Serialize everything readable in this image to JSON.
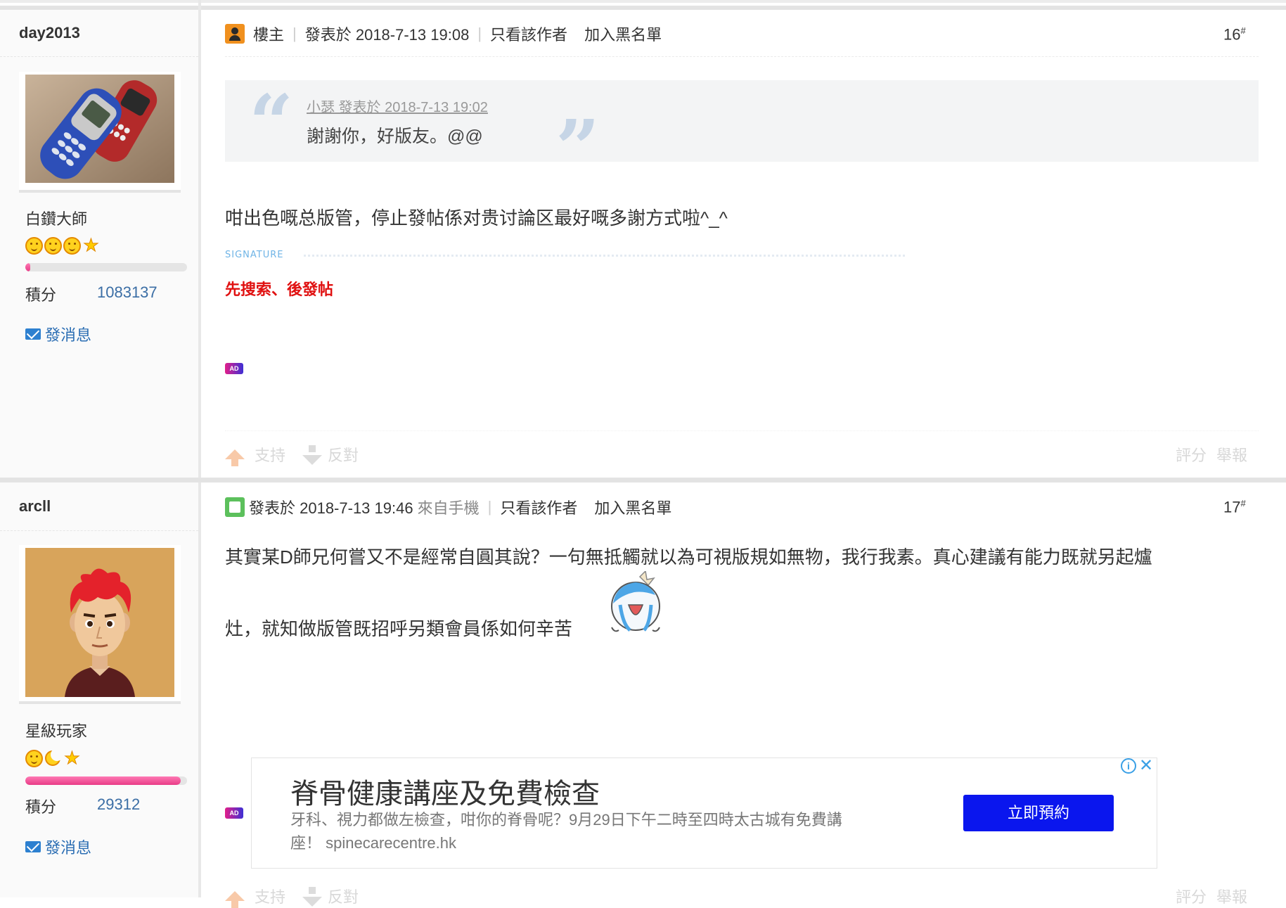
{
  "posts": [
    {
      "username": "day2013",
      "rank": "白鑽大師",
      "points_label": "積分",
      "points_value": "1083137",
      "progress": 0.02,
      "send_msg": "發消息",
      "owner_label": "樓主",
      "posted_at": "發表於 2018-7-13 19:08",
      "only_author": "只看該作者",
      "blacklist": "加入黑名單",
      "floor": "16",
      "floor_sup": "#",
      "quote_from": "小瑟 發表於 2018-7-13 19:02",
      "quote_text": "謝謝你，好版友。@@",
      "content": "咁出色嘅总版管，停止發帖係对贵讨論区最好嘅多謝方式啦^_^",
      "signature_label": "SIGNATURE",
      "signature": "先搜索、後發帖",
      "ad_tag": "AD",
      "support": "支持",
      "oppose": "反對",
      "rate": "評分",
      "report": "舉報"
    },
    {
      "username": "arcll",
      "rank": "星級玩家",
      "points_label": "積分",
      "points_value": "29312",
      "progress": 0.96,
      "send_msg": "發消息",
      "posted_at": "發表於 2018-7-13 19:46",
      "from_mobile": "來自手機",
      "only_author": "只看該作者",
      "blacklist": "加入黑名單",
      "floor": "17",
      "floor_sup": "#",
      "content_line1": "其實某D師兄何嘗又不是經常自圓其說？一句無抵觸就以為可視版規如無物，我行我素。真心建議有能力既就另起爐",
      "content_line2": "灶，就知做版管既招呼另類會員係如何辛苦",
      "ad_tag": "AD",
      "support": "支持",
      "oppose": "反對",
      "rate": "評分",
      "report": "舉報"
    }
  ],
  "ad": {
    "title": "脊骨健康講座及免費檢查",
    "desc_line1": "牙科、視力都做左檢查，咁你的脊骨呢？9月29日下午二時至四時太古城有免費講",
    "desc_line2": "座！ spinecarecentre.hk",
    "button": "立即預約",
    "info": "i",
    "close": "✕"
  },
  "colors": {
    "link_blue": "#3b6ea5",
    "signature_red": "#e01010",
    "ad_button": "#0a16ee",
    "progress_pink": "#e83b86"
  }
}
